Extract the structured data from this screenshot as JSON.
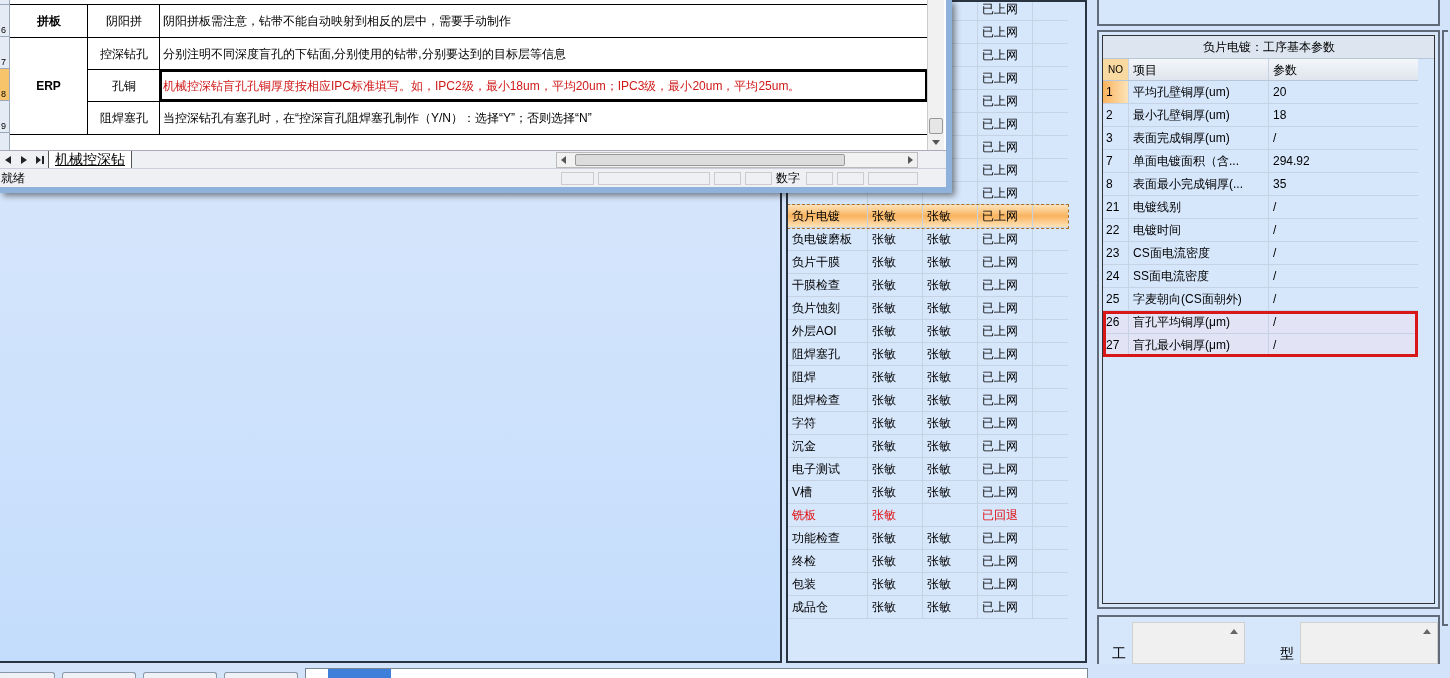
{
  "process_list": {
    "rows": [
      {
        "status": "已上网"
      },
      {
        "status": "已上网"
      },
      {
        "status": "已上网"
      },
      {
        "status": "已上网"
      },
      {
        "status": "已上网"
      },
      {
        "status": "已上网"
      },
      {
        "status": "已上网"
      },
      {
        "status": "已上网"
      },
      {
        "status": "已上网"
      },
      {
        "name": "负片电镀",
        "operator": "张敏",
        "checker": "张敏",
        "status": "已上网",
        "selected": true,
        "returned": false
      },
      {
        "name": "负电镀磨板",
        "operator": "张敏",
        "checker": "张敏",
        "status": "已上网",
        "selected": false,
        "returned": false
      },
      {
        "name": "负片干膜",
        "operator": "张敏",
        "checker": "张敏",
        "status": "已上网",
        "selected": false,
        "returned": false
      },
      {
        "name": "干膜检查",
        "operator": "张敏",
        "checker": "张敏",
        "status": "已上网",
        "selected": false,
        "returned": false
      },
      {
        "name": "负片蚀刻",
        "operator": "张敏",
        "checker": "张敏",
        "status": "已上网",
        "selected": false,
        "returned": false
      },
      {
        "name": "外层AOI",
        "operator": "张敏",
        "checker": "张敏",
        "status": "已上网",
        "selected": false,
        "returned": false
      },
      {
        "name": "阻焊塞孔",
        "operator": "张敏",
        "checker": "张敏",
        "status": "已上网",
        "selected": false,
        "returned": false
      },
      {
        "name": "阻焊",
        "operator": "张敏",
        "checker": "张敏",
        "status": "已上网",
        "selected": false,
        "returned": false
      },
      {
        "name": "阻焊检查",
        "operator": "张敏",
        "checker": "张敏",
        "status": "已上网",
        "selected": false,
        "returned": false
      },
      {
        "name": "字符",
        "operator": "张敏",
        "checker": "张敏",
        "status": "已上网",
        "selected": false,
        "returned": false
      },
      {
        "name": "沉金",
        "operator": "张敏",
        "checker": "张敏",
        "status": "已上网",
        "selected": false,
        "returned": false
      },
      {
        "name": "电子测试",
        "operator": "张敏",
        "checker": "张敏",
        "status": "已上网",
        "selected": false,
        "returned": false
      },
      {
        "name": "V槽",
        "operator": "张敏",
        "checker": "张敏",
        "status": "已上网",
        "selected": false,
        "returned": false
      },
      {
        "name": "铣板",
        "operator": "张敏",
        "status": "已回退",
        "selected": false,
        "returned": true
      },
      {
        "name": "功能检查",
        "operator": "张敏",
        "checker": "张敏",
        "status": "已上网",
        "selected": false,
        "returned": false
      },
      {
        "name": "终检",
        "operator": "张敏",
        "checker": "张敏",
        "status": "已上网",
        "selected": false,
        "returned": false
      },
      {
        "name": "包装",
        "operator": "张敏",
        "checker": "张敏",
        "status": "已上网",
        "selected": false,
        "returned": false
      },
      {
        "name": "成品仓",
        "operator": "张敏",
        "checker": "张敏",
        "status": "已上网",
        "selected": false,
        "returned": false
      }
    ]
  },
  "spreadsheet": {
    "groups": [
      {
        "category": "拼板",
        "rows": [
          {
            "row_header": "6",
            "item": "阴阳拼",
            "note": "阴阳拼板需注意，钻带不能自动映射到相反的层中，需要手动制作",
            "emphasis": false,
            "selected": false
          }
        ]
      },
      {
        "category": "ERP",
        "rows": [
          {
            "row_header": "7",
            "item": "控深钻孔",
            "note": "分别注明不同深度盲孔的下钻面,分别使用的钻带,分别要达到的目标层等信息",
            "emphasis": false,
            "selected": false
          },
          {
            "row_header": "8",
            "item": "孔铜",
            "note": "机械控深钻盲孔孔铜厚度按相应IPC标准填写。如，IPC2级，最小18um，平均20um；IPC3级，最小20um，平均25um。",
            "emphasis": true,
            "selected": true
          },
          {
            "row_header": "9",
            "item": "阻焊塞孔",
            "note": "当控深钻孔有塞孔时，在“控深盲孔阻焊塞孔制作（Y/N）：选择“Y”；否则选择“N”",
            "emphasis": false,
            "selected": false
          }
        ]
      }
    ],
    "sheet_tab": "机械控深钻",
    "status_text": "就绪",
    "status_indicator": "数字"
  },
  "params_panel": {
    "title": "负片电镀：工序基本参数",
    "columns": [
      "NO",
      "项目",
      "参数"
    ],
    "rows": [
      {
        "no": "1",
        "item": "平均孔壁铜厚(um)",
        "value": "20",
        "selected": true,
        "highlighted": false
      },
      {
        "no": "2",
        "item": "最小孔壁铜厚(um)",
        "value": "18",
        "selected": false,
        "highlighted": false
      },
      {
        "no": "3",
        "item": "表面完成铜厚(um)",
        "value": "/",
        "selected": false,
        "highlighted": false
      },
      {
        "no": "7",
        "item": "单面电镀面积（含...",
        "value": "294.92",
        "selected": false,
        "highlighted": false
      },
      {
        "no": "8",
        "item": "表面最小完成铜厚(...",
        "value": "35",
        "selected": false,
        "highlighted": false
      },
      {
        "no": "21",
        "item": "电镀线别",
        "value": "/",
        "selected": false,
        "highlighted": false
      },
      {
        "no": "22",
        "item": "电镀时间",
        "value": "/",
        "selected": false,
        "highlighted": false
      },
      {
        "no": "23",
        "item": "CS面电流密度",
        "value": "/",
        "selected": false,
        "highlighted": false
      },
      {
        "no": "24",
        "item": "SS面电流密度",
        "value": "/",
        "selected": false,
        "highlighted": false
      },
      {
        "no": "25",
        "item": "字麦朝向(CS面朝外)",
        "value": "/",
        "selected": false,
        "highlighted": false
      },
      {
        "no": "26",
        "item": "盲孔平均铜厚(μm)",
        "value": "/",
        "selected": false,
        "highlighted": true
      },
      {
        "no": "27",
        "item": "盲孔最小铜厚(μm)",
        "value": "/",
        "selected": false,
        "highlighted": true
      }
    ]
  },
  "bottom_fields": [
    {
      "label": "工"
    },
    {
      "label": "型"
    }
  ]
}
